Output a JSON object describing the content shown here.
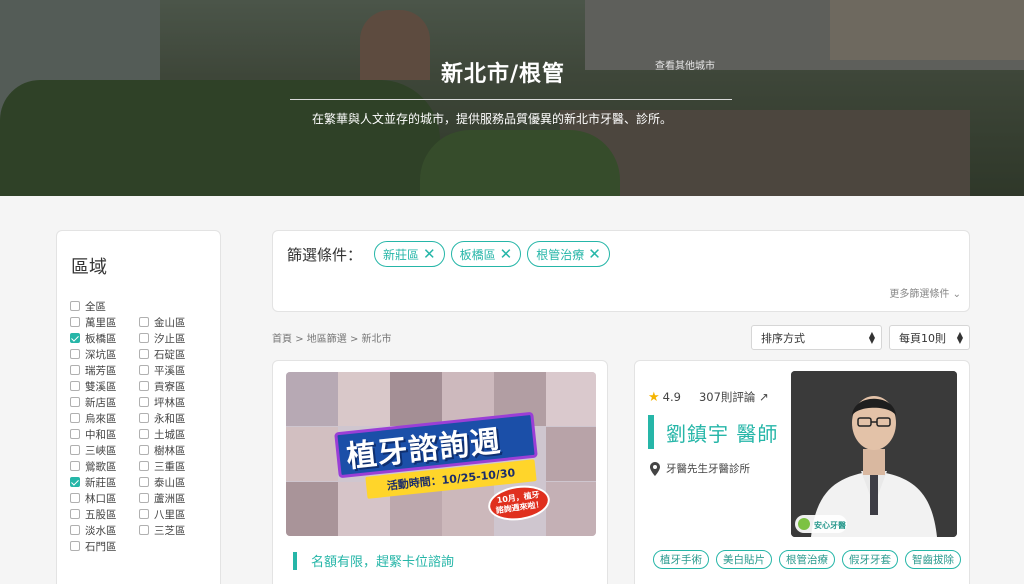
{
  "hero": {
    "title": "新北市/根管",
    "other_cities": "查看其他城市",
    "description": "在繁華與人文並存的城市，提供服務品質優異的新北市牙醫、診所。"
  },
  "sidebar": {
    "title": "區域",
    "districts": [
      {
        "label": "全區",
        "checked": false
      },
      {
        "label": "萬里區",
        "checked": false
      },
      {
        "label": "金山區",
        "checked": false
      },
      {
        "label": "板橋區",
        "checked": true
      },
      {
        "label": "汐止區",
        "checked": false
      },
      {
        "label": "深坑區",
        "checked": false
      },
      {
        "label": "石碇區",
        "checked": false
      },
      {
        "label": "瑞芳區",
        "checked": false
      },
      {
        "label": "平溪區",
        "checked": false
      },
      {
        "label": "雙溪區",
        "checked": false
      },
      {
        "label": "貢寮區",
        "checked": false
      },
      {
        "label": "新店區",
        "checked": false
      },
      {
        "label": "坪林區",
        "checked": false
      },
      {
        "label": "烏來區",
        "checked": false
      },
      {
        "label": "永和區",
        "checked": false
      },
      {
        "label": "中和區",
        "checked": false
      },
      {
        "label": "土城區",
        "checked": false
      },
      {
        "label": "三峽區",
        "checked": false
      },
      {
        "label": "樹林區",
        "checked": false
      },
      {
        "label": "鶯歌區",
        "checked": false
      },
      {
        "label": "三重區",
        "checked": false
      },
      {
        "label": "新莊區",
        "checked": true
      },
      {
        "label": "泰山區",
        "checked": false
      },
      {
        "label": "林口區",
        "checked": false
      },
      {
        "label": "蘆洲區",
        "checked": false
      },
      {
        "label": "五股區",
        "checked": false
      },
      {
        "label": "八里區",
        "checked": false
      },
      {
        "label": "淡水區",
        "checked": false
      },
      {
        "label": "三芝區",
        "checked": false
      },
      {
        "label": "石門區",
        "checked": false
      }
    ]
  },
  "filter": {
    "label": "篩選條件：",
    "chips": [
      "新莊區",
      "板橋區",
      "根管治療"
    ],
    "more": "更多篩選條件"
  },
  "breadcrumb": {
    "home": "首頁",
    "region_filter": "地區篩選",
    "city": "新北市"
  },
  "sort": {
    "selected": "排序方式"
  },
  "per_page": {
    "selected": "每頁10則"
  },
  "promo_card": {
    "headline": "植牙諮詢週",
    "dates": "活動時間：10/25-10/30",
    "badge_line1": "10月，植牙",
    "badge_line2": "諮詢週來啦！",
    "note": "名額有限，趕緊卡位諮詢"
  },
  "doctor_card": {
    "rating": "4.9",
    "reviews": "307則評論",
    "name": "劉鎮宇 醫師",
    "clinic": "牙醫先生牙醫診所",
    "badge": "安心牙醫",
    "tags": [
      "植牙手術",
      "美白貼片",
      "根管治療",
      "假牙牙套",
      "智齒拔除"
    ]
  },
  "colors": {
    "accent": "#26b6a8",
    "star": "#f5b400"
  }
}
